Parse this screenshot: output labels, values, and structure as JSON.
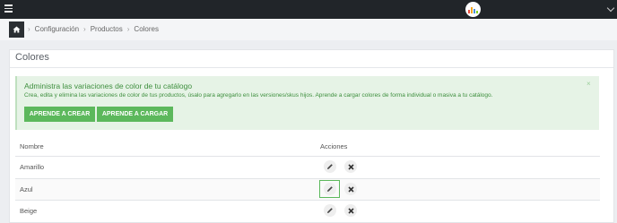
{
  "topbar": {
    "menu_icon": "hamburger-icon",
    "avatar_icon": "bar-chart-logo-icon",
    "dropdown_icon": "chevron-down-icon"
  },
  "breadcrumb": {
    "home_icon": "home-icon",
    "items": [
      "Configuración",
      "Productos",
      "Colores"
    ],
    "separator": "›"
  },
  "panel": {
    "title": "Colores"
  },
  "alert": {
    "title": "Administra las variaciones de color de tu catálogo",
    "body": "Crea, edita y elimina las variaciones de color de tus productos, úsalo para agregarlo en las versiones/skus hijos. Aprende a cargar colores de forma individual o masiva a tu catálogo.",
    "close": "×",
    "buttons": [
      "APRENDE A CREAR",
      "APRENDE A CARGAR"
    ]
  },
  "table": {
    "headers": [
      "Nombre",
      "Acciones"
    ],
    "rows": [
      "Amarillo",
      "Azul",
      "Beige"
    ],
    "action_icons": [
      "pencil-icon",
      "close-icon"
    ]
  },
  "colors": {
    "accent": "#5cb85c",
    "alert_bg": "#e6f3e6",
    "alert_text": "#3e8f3e",
    "topbar": "#212529"
  }
}
